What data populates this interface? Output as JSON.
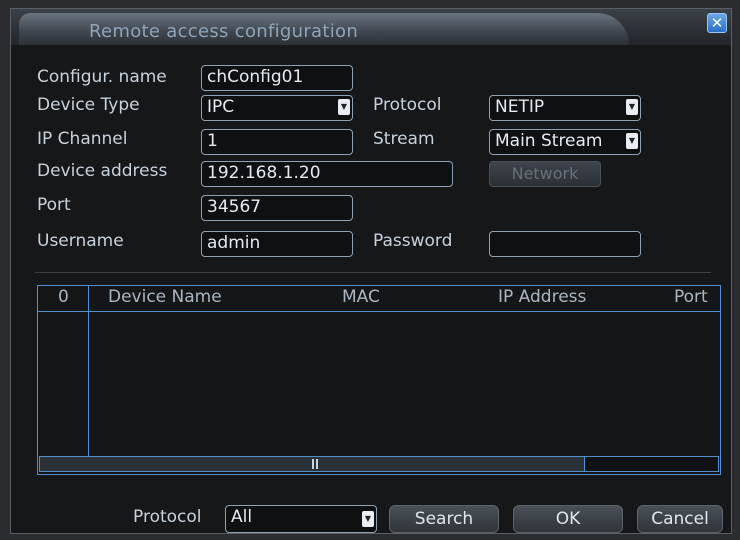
{
  "window": {
    "title": "Remote access configuration"
  },
  "form": {
    "config_name_label": "Configur. name",
    "config_name_value": "chConfig01",
    "device_type_label": "Device Type",
    "device_type_value": "IPC",
    "protocol_label": "Protocol",
    "protocol_value": "NETIP",
    "ip_channel_label": "IP Channel",
    "ip_channel_value": "1",
    "stream_label": "Stream",
    "stream_value": "Main Stream",
    "device_address_label": "Device address",
    "device_address_value": "192.168.1.20",
    "network_button": "Network",
    "port_label": "Port",
    "port_value": "34567",
    "username_label": "Username",
    "username_value": "admin",
    "password_label": "Password",
    "password_value": ""
  },
  "table": {
    "columns": [
      "0",
      "Device Name",
      "MAC",
      "IP Address",
      "Port"
    ],
    "rows": [],
    "scroll_position": 0
  },
  "footer": {
    "protocol_label": "Protocol",
    "protocol_value": "All",
    "search_button": "Search",
    "ok_button": "OK",
    "cancel_button": "Cancel"
  },
  "icons": {
    "close": "close-icon",
    "dropdown": "chevron-down-icon",
    "grip": "grip-icon"
  },
  "colors": {
    "accent": "#4f8fd0",
    "close_button": "#2a6fc4",
    "field_border": "#8ea2b6"
  }
}
